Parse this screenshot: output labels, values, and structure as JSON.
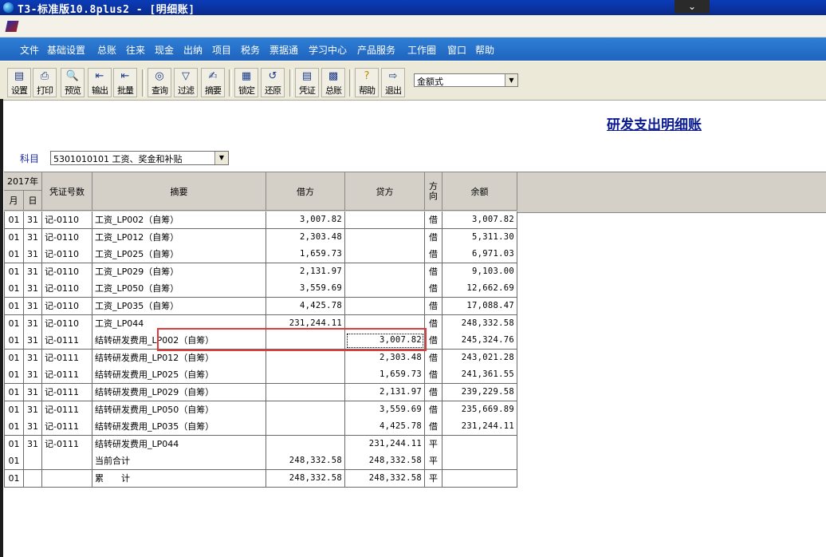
{
  "window": {
    "title": "T3-标准版10.8plus2 - [明细账]"
  },
  "menu": [
    "文件",
    "基础设置",
    "总账",
    "往来",
    "现金",
    "出纳",
    "项目",
    "税务",
    "票据通",
    "学习中心",
    "产品服务",
    "工作圈",
    "窗口",
    "帮助"
  ],
  "toolbar": {
    "buttons": [
      {
        "label": "设置",
        "icon": "settings-icon"
      },
      {
        "label": "打印",
        "icon": "print-icon"
      },
      {
        "label": "预览",
        "icon": "preview-icon"
      },
      {
        "label": "输出",
        "icon": "export-icon"
      },
      {
        "label": "批量",
        "icon": "batch-icon"
      },
      {
        "label": "查询",
        "icon": "binoculars-icon"
      },
      {
        "label": "过滤",
        "icon": "filter-icon"
      },
      {
        "label": "摘要",
        "icon": "summary-icon"
      },
      {
        "label": "锁定",
        "icon": "lock-icon"
      },
      {
        "label": "还原",
        "icon": "restore-icon"
      },
      {
        "label": "凭证",
        "icon": "voucher-icon"
      },
      {
        "label": "总账",
        "icon": "ledger-icon"
      },
      {
        "label": "帮助",
        "icon": "help-icon"
      },
      {
        "label": "退出",
        "icon": "exit-icon"
      }
    ],
    "format_select": "金额式"
  },
  "report": {
    "title": "研发支出明细账",
    "account_label": "科目",
    "account_value": "5301010101 工资、奖金和补贴"
  },
  "table": {
    "headers": {
      "year": "2017年",
      "month": "月",
      "day": "日",
      "voucher_no": "凭证号数",
      "summary": "摘要",
      "debit": "借方",
      "credit": "贷方",
      "direction": "方向",
      "balance": "余额"
    },
    "rows": [
      {
        "m": "01",
        "d": "31",
        "v": "记-0110",
        "s": "工资_LP002（自筹）",
        "dr": "3,007.82",
        "cr": "",
        "dir": "借",
        "bal": "3,007.82"
      },
      {
        "m": "01",
        "d": "31",
        "v": "记-0110",
        "s": "工资_LP012（自筹）",
        "dr": "2,303.48",
        "cr": "",
        "dir": "借",
        "bal": "5,311.30"
      },
      {
        "m": "01",
        "d": "31",
        "v": "记-0110",
        "s": "工资_LP025（自筹）",
        "dr": "1,659.73",
        "cr": "",
        "dir": "借",
        "bal": "6,971.03"
      },
      {
        "m": "01",
        "d": "31",
        "v": "记-0110",
        "s": "工资_LP029（自筹）",
        "dr": "2,131.97",
        "cr": "",
        "dir": "借",
        "bal": "9,103.00"
      },
      {
        "m": "01",
        "d": "31",
        "v": "记-0110",
        "s": "工资_LP050（自筹）",
        "dr": "3,559.69",
        "cr": "",
        "dir": "借",
        "bal": "12,662.69"
      },
      {
        "m": "01",
        "d": "31",
        "v": "记-0110",
        "s": "工资_LP035（自筹）",
        "dr": "4,425.78",
        "cr": "",
        "dir": "借",
        "bal": "17,088.47"
      },
      {
        "m": "01",
        "d": "31",
        "v": "记-0110",
        "s": "工资_LP044",
        "dr": "231,244.11",
        "cr": "",
        "dir": "借",
        "bal": "248,332.58"
      },
      {
        "m": "01",
        "d": "31",
        "v": "记-0111",
        "s": "结转研发费用_LP002（自筹）",
        "dr": "",
        "cr": "3,007.82",
        "dir": "借",
        "bal": "245,324.76"
      },
      {
        "m": "01",
        "d": "31",
        "v": "记-0111",
        "s": "结转研发费用_LP012（自筹）",
        "dr": "",
        "cr": "2,303.48",
        "dir": "借",
        "bal": "243,021.28"
      },
      {
        "m": "01",
        "d": "31",
        "v": "记-0111",
        "s": "结转研发费用_LP025（自筹）",
        "dr": "",
        "cr": "1,659.73",
        "dir": "借",
        "bal": "241,361.55"
      },
      {
        "m": "01",
        "d": "31",
        "v": "记-0111",
        "s": "结转研发费用_LP029（自筹）",
        "dr": "",
        "cr": "2,131.97",
        "dir": "借",
        "bal": "239,229.58"
      },
      {
        "m": "01",
        "d": "31",
        "v": "记-0111",
        "s": "结转研发费用_LP050（自筹）",
        "dr": "",
        "cr": "3,559.69",
        "dir": "借",
        "bal": "235,669.89"
      },
      {
        "m": "01",
        "d": "31",
        "v": "记-0111",
        "s": "结转研发费用_LP035（自筹）",
        "dr": "",
        "cr": "4,425.78",
        "dir": "借",
        "bal": "231,244.11"
      },
      {
        "m": "01",
        "d": "31",
        "v": "记-0111",
        "s": "结转研发费用_LP044",
        "dr": "",
        "cr": "231,244.11",
        "dir": "平",
        "bal": ""
      },
      {
        "m": "01",
        "d": "",
        "v": "",
        "s": "当前合计",
        "dr": "248,332.58",
        "cr": "248,332.58",
        "dir": "平",
        "bal": ""
      },
      {
        "m": "01",
        "d": "",
        "v": "",
        "s": "累　　计",
        "dr": "248,332.58",
        "cr": "248,332.58",
        "dir": "平",
        "bal": ""
      }
    ]
  },
  "highlight_color": "#e03a3a",
  "accent_color": "#1f63bd"
}
